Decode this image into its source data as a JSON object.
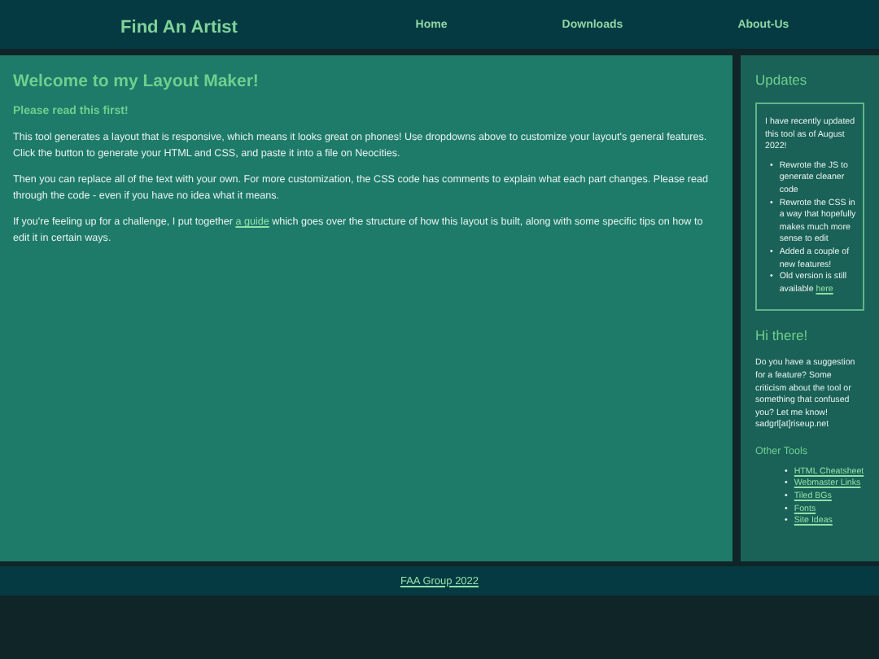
{
  "header": {
    "title": "Find An Artist",
    "nav": [
      {
        "label": "Home"
      },
      {
        "label": "Downloads"
      },
      {
        "label": "About-Us"
      }
    ]
  },
  "main": {
    "heading": "Welcome to my Layout Maker!",
    "subheading": "Please read this first!",
    "paragraphs": [
      {
        "text": "This tool generates a layout that is responsive, which means it looks great on phones! Use dropdowns above to customize your layout's general features. Click the button to generate your HTML and CSS, and paste it into a file on Neocities."
      },
      {
        "text": "Then you can replace all of the text with your own. For more customization, the CSS code has comments to explain what each part changes. Please read through the code - even if you have no idea what it means."
      },
      {
        "text": "If you're feeling up for a challenge, I put together ",
        "link": "a guide",
        "after": " which goes over the structure of how this layout is built, along with some specific tips on how to edit it in certain ways."
      }
    ]
  },
  "sidebar": {
    "updates": {
      "heading": "Updates",
      "intro": "I have recently updated this tool as of August 2022!",
      "items": [
        {
          "bullet": "•",
          "text": "Rewrote the JS to generate cleaner code"
        },
        {
          "bullet": "•",
          "text": "Rewrote the CSS in a way that hopefully makes much more sense to edit"
        },
        {
          "bullet": "•",
          "text": "Added a couple of new features!"
        },
        {
          "bullet": "•",
          "text": "Old version is still available ",
          "link": "here"
        }
      ]
    },
    "hi": {
      "heading": "Hi there!",
      "text": "Do you have a suggestion for a feature? Some criticism about the tool or something that confused you? Let me know! sadgrl[at]riseup.net"
    },
    "tools": {
      "heading": "Other Tools",
      "links": [
        {
          "bullet": "•",
          "label": "HTML Cheatsheet"
        },
        {
          "bullet": "•",
          "label": "Webmaster Links"
        },
        {
          "bullet": "•",
          "label": "Tiled BGs"
        },
        {
          "bullet": "•",
          "label": "Fonts"
        },
        {
          "bullet": "•",
          "label": "Site Ideas"
        }
      ]
    }
  },
  "footer": {
    "link": "FAA Group 2022"
  }
}
